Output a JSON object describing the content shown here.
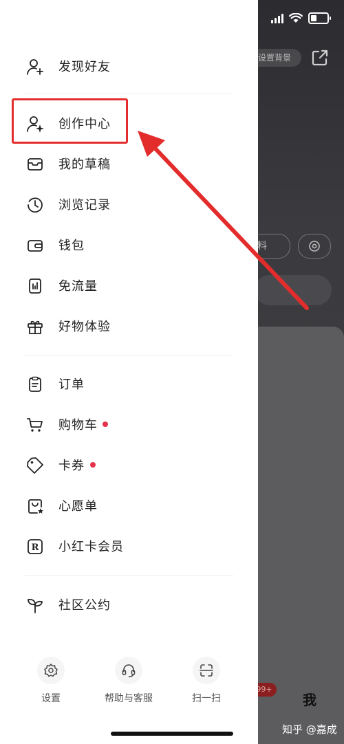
{
  "background": {
    "set_background_label": "设置背景",
    "edit_profile_partial": "料",
    "badge_count": "99+",
    "me_tab_label": "我",
    "watermark": "知乎 @嘉成"
  },
  "drawer": {
    "items": [
      {
        "label": "发现好友",
        "icon": "add-friend-icon"
      },
      {
        "label": "创作中心",
        "icon": "creator-center-icon"
      },
      {
        "label": "我的草稿",
        "icon": "drafts-tray-icon"
      },
      {
        "label": "浏览记录",
        "icon": "history-clock-icon"
      },
      {
        "label": "钱包",
        "icon": "wallet-icon"
      },
      {
        "label": "免流量",
        "icon": "data-free-icon"
      },
      {
        "label": "好物体验",
        "icon": "gift-icon"
      },
      {
        "label": "订单",
        "icon": "order-clipboard-icon"
      },
      {
        "label": "购物车",
        "icon": "shopping-cart-icon",
        "has_dot": true
      },
      {
        "label": "卡券",
        "icon": "coupon-tag-icon",
        "has_dot": true
      },
      {
        "label": "心愿单",
        "icon": "wishlist-bag-icon"
      },
      {
        "label": "小红卡会员",
        "icon": "red-card-membership-icon"
      },
      {
        "label": "社区公约",
        "icon": "sprout-icon"
      }
    ],
    "bottom": [
      {
        "label": "设置",
        "icon": "gear-icon"
      },
      {
        "label": "帮助与客服",
        "icon": "headset-icon"
      },
      {
        "label": "扫一扫",
        "icon": "scan-icon"
      }
    ]
  },
  "colors": {
    "accent_red": "#e32d2d",
    "notification_dot": "#e5334b"
  }
}
